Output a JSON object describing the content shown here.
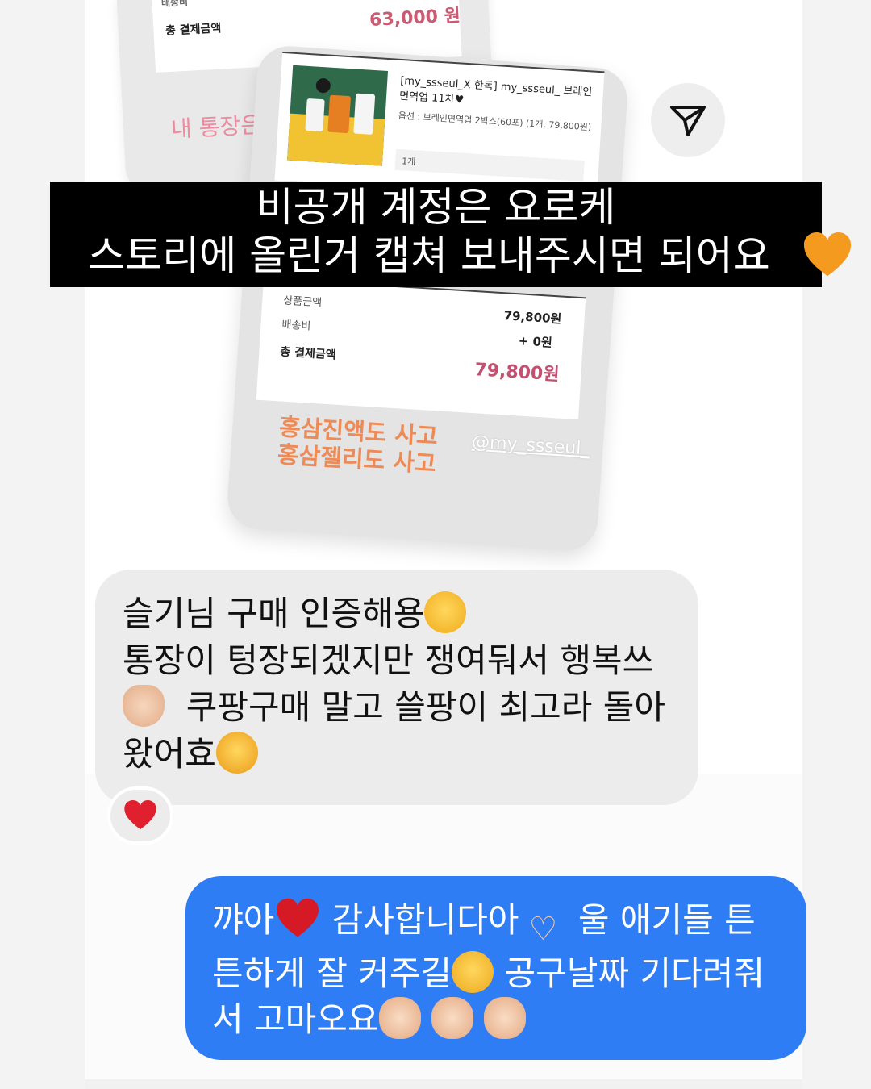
{
  "colors": {
    "bubble_incoming": "#ececec",
    "bubble_outgoing": "#2f7df4",
    "banner": "#000000",
    "pink_text": "#f08aa0",
    "orange_text": "#ee8a56",
    "price_accent": "#c25070"
  },
  "story": {
    "back_receipt": {
      "shipping_label": "배송비",
      "total_label": "총 결제금액",
      "total_value": "63,000 원",
      "overlay_text": "내 통장은"
    },
    "front_receipt": {
      "product_title": "[my_ssseul_X 한독] my_ssseul_ 브레인면역업 11차♥",
      "product_option": "옵션 : 브레인면역업 2박스(60포) (1개, 79,800원)",
      "quantity": "1개",
      "subtotal_label": "상품금액",
      "subtotal_value": "79,800원",
      "shipping_label": "배송비",
      "shipping_value": "+ 0원",
      "total_label": "총 결제금액",
      "total_value": "79,800원",
      "overlay_line1": "홍삼진액도 사고",
      "overlay_line2": "홍삼젤리도 사고",
      "watermark": "@my_ssseul_"
    },
    "send_icon": "paper-plane-icon"
  },
  "banner": {
    "line1": "비공개 계정은 요로케",
    "line2": "스토리에 올린거 캡쳐 보내주시면 되어요",
    "emoji": "orange-heart"
  },
  "messages": {
    "incoming": {
      "line1": "슬기님 구매 인증해용",
      "line2": "통장이 텅장되겠지만 쟁여둬서 행복쓰",
      "line3": "쿠팡구매 말고 쓸팡이 최고라 돌아",
      "line4": "왔어효",
      "reaction": "❤️"
    },
    "outgoing": {
      "line1a": "꺄아",
      "line1b": "감사합니다아",
      "line1c": "울 애기들 튼",
      "line2a": "튼하게 잘 커주길",
      "line2b": "공구날짜 기다려줘",
      "line3": "서 고마오요"
    }
  }
}
